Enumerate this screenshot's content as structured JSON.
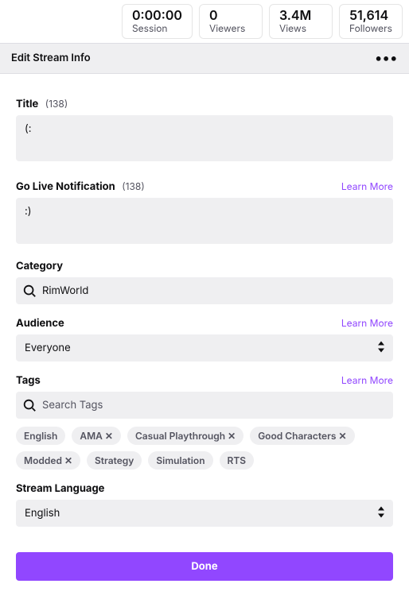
{
  "stats": {
    "session": {
      "value": "0:00:00",
      "label": "Session"
    },
    "viewers": {
      "value": "0",
      "label": "Viewers"
    },
    "views": {
      "value": "3.4M",
      "label": "Views"
    },
    "followers": {
      "value": "51,614",
      "label": "Followers"
    }
  },
  "panel": {
    "title": "Edit Stream Info"
  },
  "title": {
    "label": "Title",
    "count": "(138)",
    "value": "(:"
  },
  "notification": {
    "label": "Go Live Notification",
    "count": "(138)",
    "learn": "Learn More",
    "value": ":)"
  },
  "category": {
    "label": "Category",
    "value": "RimWorld"
  },
  "audience": {
    "label": "Audience",
    "learn": "Learn More",
    "value": "Everyone"
  },
  "tags": {
    "label": "Tags",
    "learn": "Learn More",
    "placeholder": "Search Tags",
    "items": [
      {
        "text": "English",
        "removable": false
      },
      {
        "text": "AMA",
        "removable": true
      },
      {
        "text": "Casual Playthrough",
        "removable": true
      },
      {
        "text": "Good Characters",
        "removable": true
      },
      {
        "text": "Modded",
        "removable": true
      },
      {
        "text": "Strategy",
        "removable": false
      },
      {
        "text": "Simulation",
        "removable": false
      },
      {
        "text": "RTS",
        "removable": false
      }
    ]
  },
  "language": {
    "label": "Stream Language",
    "value": "English"
  },
  "done": "Done"
}
